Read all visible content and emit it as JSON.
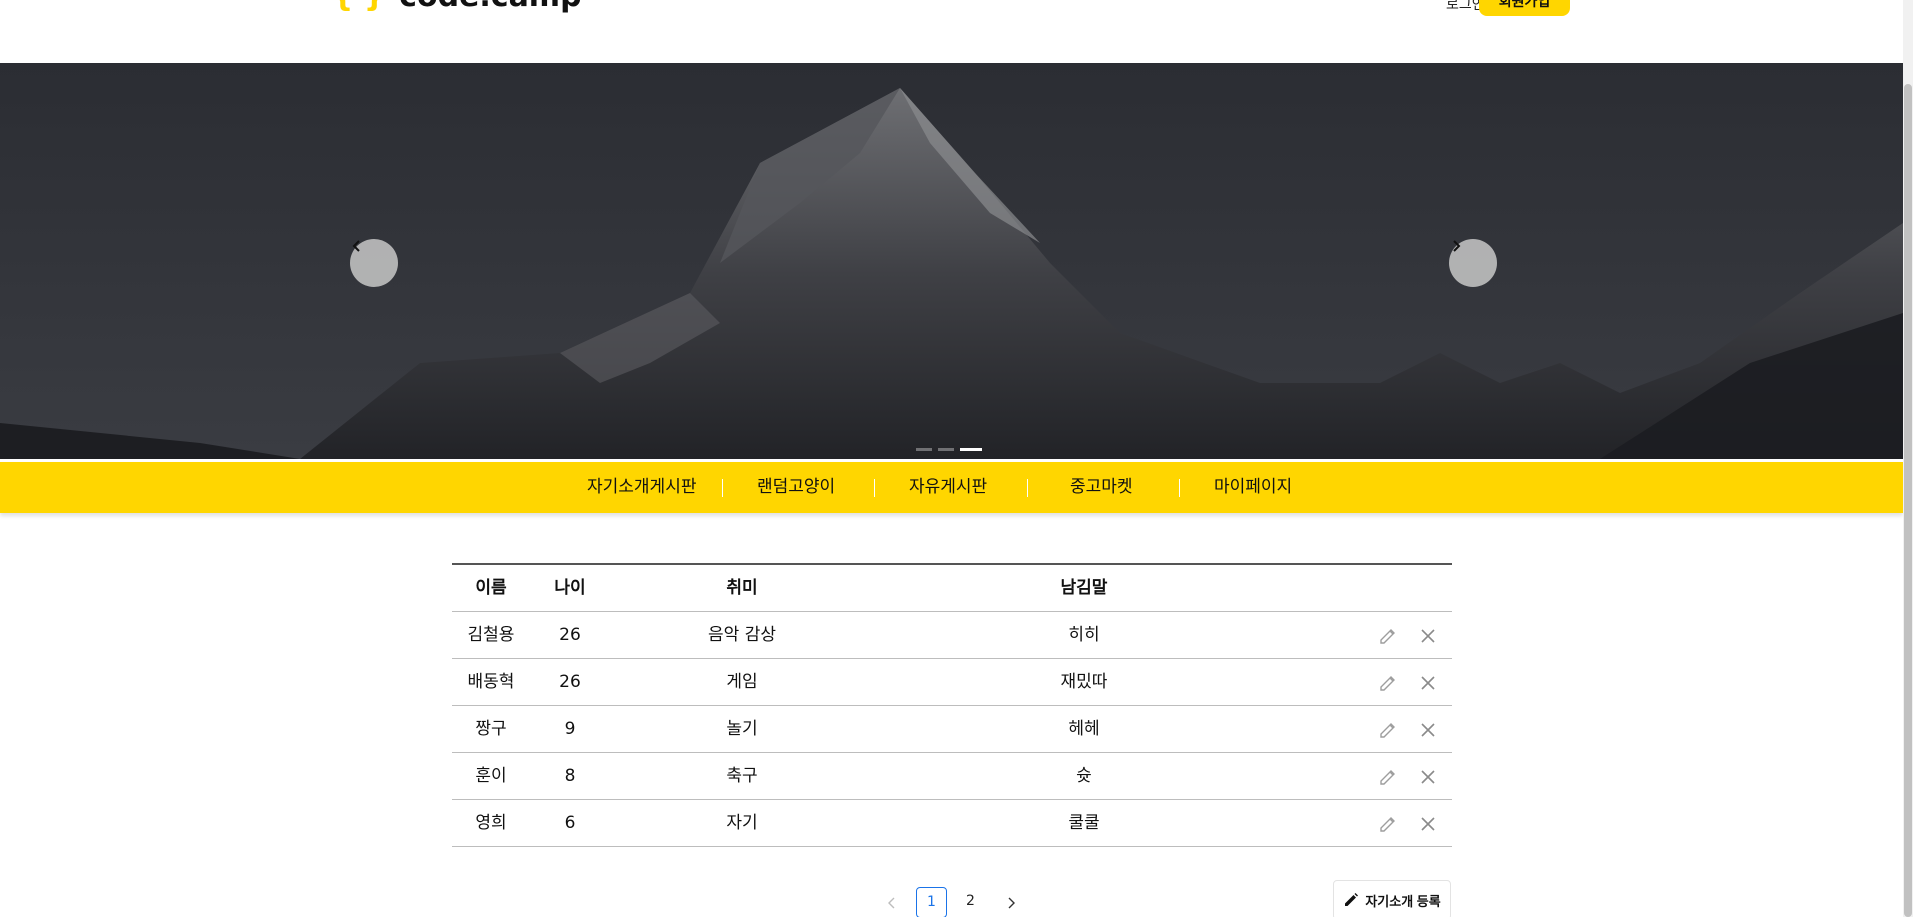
{
  "header": {
    "logo_text": "code.camp",
    "logo_braces": "{ }",
    "login_label": "로그인",
    "signup_label": "회원가입"
  },
  "banner": {
    "slide_count": 3,
    "active_slide": 3,
    "prev_icon": "chevron-left-icon",
    "next_icon": "chevron-right-icon"
  },
  "nav": {
    "items": [
      {
        "label": "자기소개게시판"
      },
      {
        "label": "랜덤고양이"
      },
      {
        "label": "자유게시판"
      },
      {
        "label": "중고마켓"
      },
      {
        "label": "마이페이지"
      }
    ]
  },
  "table": {
    "headers": {
      "name": "이름",
      "age": "나이",
      "hobby": "취미",
      "message": "남김말"
    },
    "rows": [
      {
        "name": "김철용",
        "age": "26",
        "hobby": "음악 감상",
        "message": "히히"
      },
      {
        "name": "배동혁",
        "age": "26",
        "hobby": "게임",
        "message": "재밌따"
      },
      {
        "name": "짱구",
        "age": "9",
        "hobby": "놀기",
        "message": "헤헤"
      },
      {
        "name": "훈이",
        "age": "8",
        "hobby": "축구",
        "message": "슛"
      },
      {
        "name": "영희",
        "age": "6",
        "hobby": "자기",
        "message": "쿨쿨"
      }
    ]
  },
  "pagination": {
    "pages": [
      "1",
      "2"
    ],
    "current": "1"
  },
  "register_button_label": "자기소개 등록",
  "colors": {
    "brand_yellow": "#ffd600",
    "active_page": "#1a73e8"
  }
}
